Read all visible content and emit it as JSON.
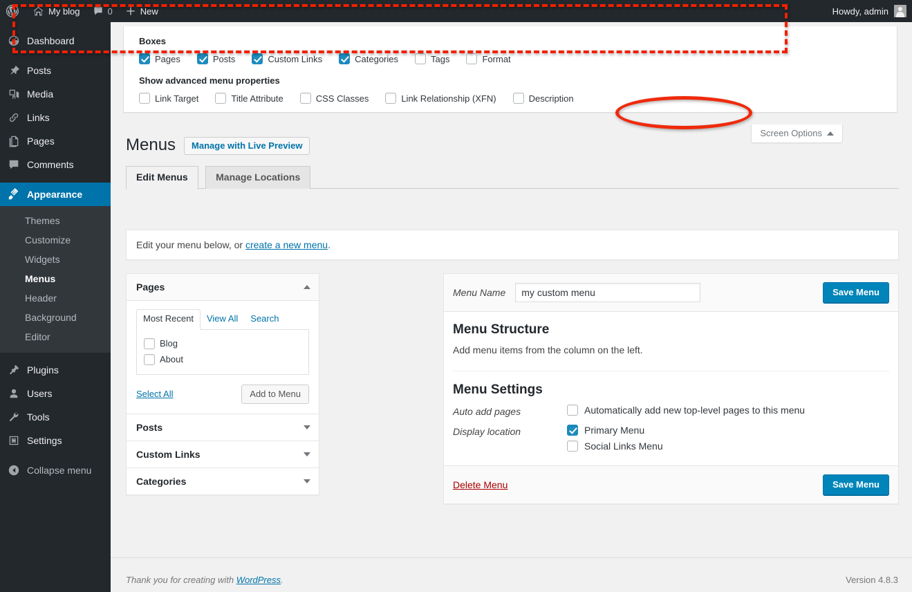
{
  "adminbar": {
    "logo_icon": "wordpress-logo-icon",
    "site_name": "My blog",
    "home_icon": "home-icon",
    "comments_icon": "comment-bubble-icon",
    "comments_count": "0",
    "new_icon": "plus-icon",
    "new_label": "New",
    "howdy": "Howdy, admin",
    "avatar_icon": "avatar-icon"
  },
  "sidebar": {
    "items": [
      {
        "label": "Dashboard",
        "icon": "dashboard-icon",
        "current": false
      },
      {
        "label": "Posts",
        "icon": "pin-icon",
        "current": false
      },
      {
        "label": "Media",
        "icon": "media-icon",
        "current": false
      },
      {
        "label": "Links",
        "icon": "link-icon",
        "current": false
      },
      {
        "label": "Pages",
        "icon": "page-icon",
        "current": false
      },
      {
        "label": "Comments",
        "icon": "comment-icon",
        "current": false
      },
      {
        "label": "Appearance",
        "icon": "brush-icon",
        "current": true
      }
    ],
    "submenu": [
      {
        "label": "Themes",
        "current": false
      },
      {
        "label": "Customize",
        "current": false
      },
      {
        "label": "Widgets",
        "current": false
      },
      {
        "label": "Menus",
        "current": true
      },
      {
        "label": "Header",
        "current": false
      },
      {
        "label": "Background",
        "current": false
      },
      {
        "label": "Editor",
        "current": false
      }
    ],
    "items_lower": [
      {
        "label": "Plugins",
        "icon": "plug-icon"
      },
      {
        "label": "Users",
        "icon": "user-icon"
      },
      {
        "label": "Tools",
        "icon": "wrench-icon"
      },
      {
        "label": "Settings",
        "icon": "settings-icon"
      }
    ],
    "collapse": {
      "label": "Collapse menu",
      "icon": "collapse-arrow-icon"
    }
  },
  "screen_options": {
    "tab_label": "Screen Options",
    "tab_caret": "caret-up-icon",
    "boxes_legend": "Boxes",
    "boxes": [
      {
        "label": "Pages",
        "checked": true
      },
      {
        "label": "Posts",
        "checked": true
      },
      {
        "label": "Custom Links",
        "checked": true
      },
      {
        "label": "Categories",
        "checked": true
      },
      {
        "label": "Tags",
        "checked": false
      },
      {
        "label": "Format",
        "checked": false
      }
    ],
    "advanced_legend": "Show advanced menu properties",
    "advanced": [
      {
        "label": "Link Target",
        "checked": false
      },
      {
        "label": "Title Attribute",
        "checked": false
      },
      {
        "label": "CSS Classes",
        "checked": false
      },
      {
        "label": "Link Relationship (XFN)",
        "checked": false
      },
      {
        "label": "Description",
        "checked": false
      }
    ]
  },
  "annotations": {
    "dashed_box_color": "#f22000",
    "oval_color": "#ef2a0c"
  },
  "page": {
    "title": "Menus",
    "live_preview_button": "Manage with Live Preview",
    "tabs": [
      {
        "label": "Edit Menus",
        "active": true
      },
      {
        "label": "Manage Locations",
        "active": false
      }
    ],
    "notice_prefix": "Edit your menu below, or ",
    "notice_link": "create a new menu",
    "notice_suffix": "."
  },
  "left_column": {
    "sections": [
      {
        "title": "Pages",
        "expanded": true,
        "toggle_icon": "triangle-up-icon"
      },
      {
        "title": "Posts",
        "expanded": false,
        "toggle_icon": "triangle-down-icon"
      },
      {
        "title": "Custom Links",
        "expanded": false,
        "toggle_icon": "triangle-down-icon"
      },
      {
        "title": "Categories",
        "expanded": false,
        "toggle_icon": "triangle-down-icon"
      }
    ],
    "pages_panel": {
      "tabs": [
        {
          "label": "Most Recent",
          "active": true
        },
        {
          "label": "View All",
          "active": false
        },
        {
          "label": "Search",
          "active": false
        }
      ],
      "items": [
        {
          "label": "Blog",
          "checked": false
        },
        {
          "label": "About",
          "checked": false
        }
      ],
      "select_all": "Select All",
      "add_to_menu": "Add to Menu"
    }
  },
  "menu_editor": {
    "name_label": "Menu Name",
    "name_value": "my custom menu",
    "name_placeholder": "Menu Name",
    "save_top": "Save Menu",
    "structure_title": "Menu Structure",
    "structure_hint": "Add menu items from the column on the left.",
    "settings_title": "Menu Settings",
    "auto_add_label": "Auto add pages",
    "auto_add_option": "Automatically add new top-level pages to this menu",
    "auto_add_checked": false,
    "display_location_label": "Display location",
    "locations": [
      {
        "label": "Primary Menu",
        "checked": true
      },
      {
        "label": "Social Links Menu",
        "checked": false
      }
    ],
    "delete_link": "Delete Menu",
    "save_bottom": "Save Menu"
  },
  "footer": {
    "thanks_prefix": "Thank you for creating with ",
    "thanks_link": "WordPress",
    "thanks_suffix": ".",
    "version": "Version 4.8.3"
  }
}
